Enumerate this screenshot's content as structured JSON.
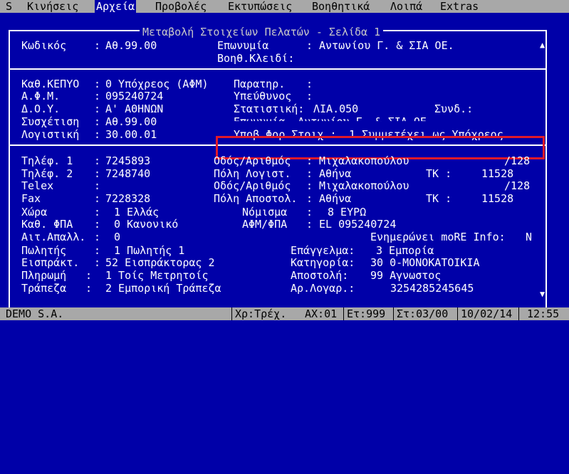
{
  "menu": [
    "S",
    "Κινήσεις",
    "Αρχεία",
    "Προβολές",
    "Εκτυπώσεις",
    "Βοηθητικά",
    "Λοιπά",
    "Extras"
  ],
  "form": {
    "title": "Μεταβολή Στοιχείων Πελατών - Σελίδα 1",
    "kodikos_label": "Κωδικός",
    "kodikos": "Αθ.99.00",
    "eponymia_label": "Επωνυμία",
    "eponymia": "Αντωνίου Γ. & ΣΙΑ ΟΕ.",
    "voith_label": "Βοηθ.Κλειδί:",
    "kepyo_label": "Καθ.ΚΕΠΥΟ",
    "kepyo": "0 Υπόχρεος (ΑΦΜ)",
    "afm_label": "Α.Φ.Μ.",
    "afm": "095240724",
    "doy_label": "Δ.Ο.Υ.",
    "doy": "Α' ΑΘΗΝΩΝ",
    "sysxetisi_label": "Συσχέτιση",
    "sysxetisi": "Αθ.99.00",
    "logistiki_label": "Λογιστική",
    "logistiki": "30.00.01",
    "paratir_label": "Παρατηρ.",
    "ypefthynos_label": "Υπεύθυνος",
    "statistiki_label": "Στατιστική:",
    "statistiki": "ΛΙΑ.050",
    "synd_label": "Συνδ.:",
    "hidden_row": "Επωνυμία  Αντωνίου Γ. & ΣΙΑ ΟΕ.",
    "ypov_label": "Υποβ.Φορ.Στοιχ.:",
    "ypov": "1 Συμμετέχει ως Υπόχρεος",
    "til1_label": "Τηλέφ. 1",
    "til1": "7245893",
    "til2_label": "Τηλέφ. 2",
    "til2": "7248740",
    "telex_label": "Telex",
    "fax_label": "Fax",
    "fax": "7228328",
    "xora_label": "Χώρα",
    "xora": "1 Ελλάς",
    "fpa_label": "Καθ. ΦΠΑ",
    "fpa": "0 Κανονικό",
    "aitapal_label": "Αιτ.Απαλλ.",
    "aitapal": "0",
    "politis_label": "Πωλητής",
    "politis": "1 Πωλητής 1",
    "eispr_label": "Εισπράκτ.",
    "eispr": "52 Εισπράκτορας 2",
    "pliromi_label": "Πληρωμή",
    "pliromi": "1 Τοίς Μετρητοίς",
    "trapeza_label": "Τράπεζα",
    "trapeza": "2 Εμπορική Τράπεζα",
    "odos1_label": "Οδός/Αριθμός",
    "odos1": "Μιχαλακοπούλου",
    "odos1_num": "/128",
    "poli1_label": "Πόλη Λογιστ.",
    "poli1": "Αθήνα",
    "tk1_label": "ΤΚ :",
    "tk1": "11528",
    "odos2_label": "Οδός/Αριθμός",
    "odos2": "Μιχαλακοπούλου",
    "odos2_num": "/128",
    "poli2_label": "Πόλη Αποστολ.",
    "poli2": "Αθήνα",
    "tk2_label": "ΤΚ :",
    "tk2": "11528",
    "nomisma_label": "Νόμισμα",
    "nomisma": "8 ΕΥΡΩ",
    "afmfpa_label": "ΑΦΜ/ΦΠΑ",
    "afmfpa": "EL 095240724",
    "more_label": "Ενημερώνει moRE Info:",
    "more": "N",
    "epaggelma_label": "Επάγγελμα:",
    "epaggelma": "3 Εμπορία",
    "katigoria_label": "Κατηγορία:",
    "katigoria": "30 0-ΜΟΝΟΚΑΤΟΙΚΙΑ",
    "apostoli_label": "Αποστολή:",
    "apostoli": "99 Αγνωστος",
    "arlog_label": "Αρ.Λογαρ.:",
    "arlog": "3254285245645"
  },
  "status": {
    "company": "DEMO S.A.",
    "xr": "Χρ:Τρέχ.",
    "ax": "ΑΧ:01",
    "et": "Ετ:999",
    "st": "Στ:03/00",
    "date": "10/02/14",
    "time": "12:55"
  }
}
